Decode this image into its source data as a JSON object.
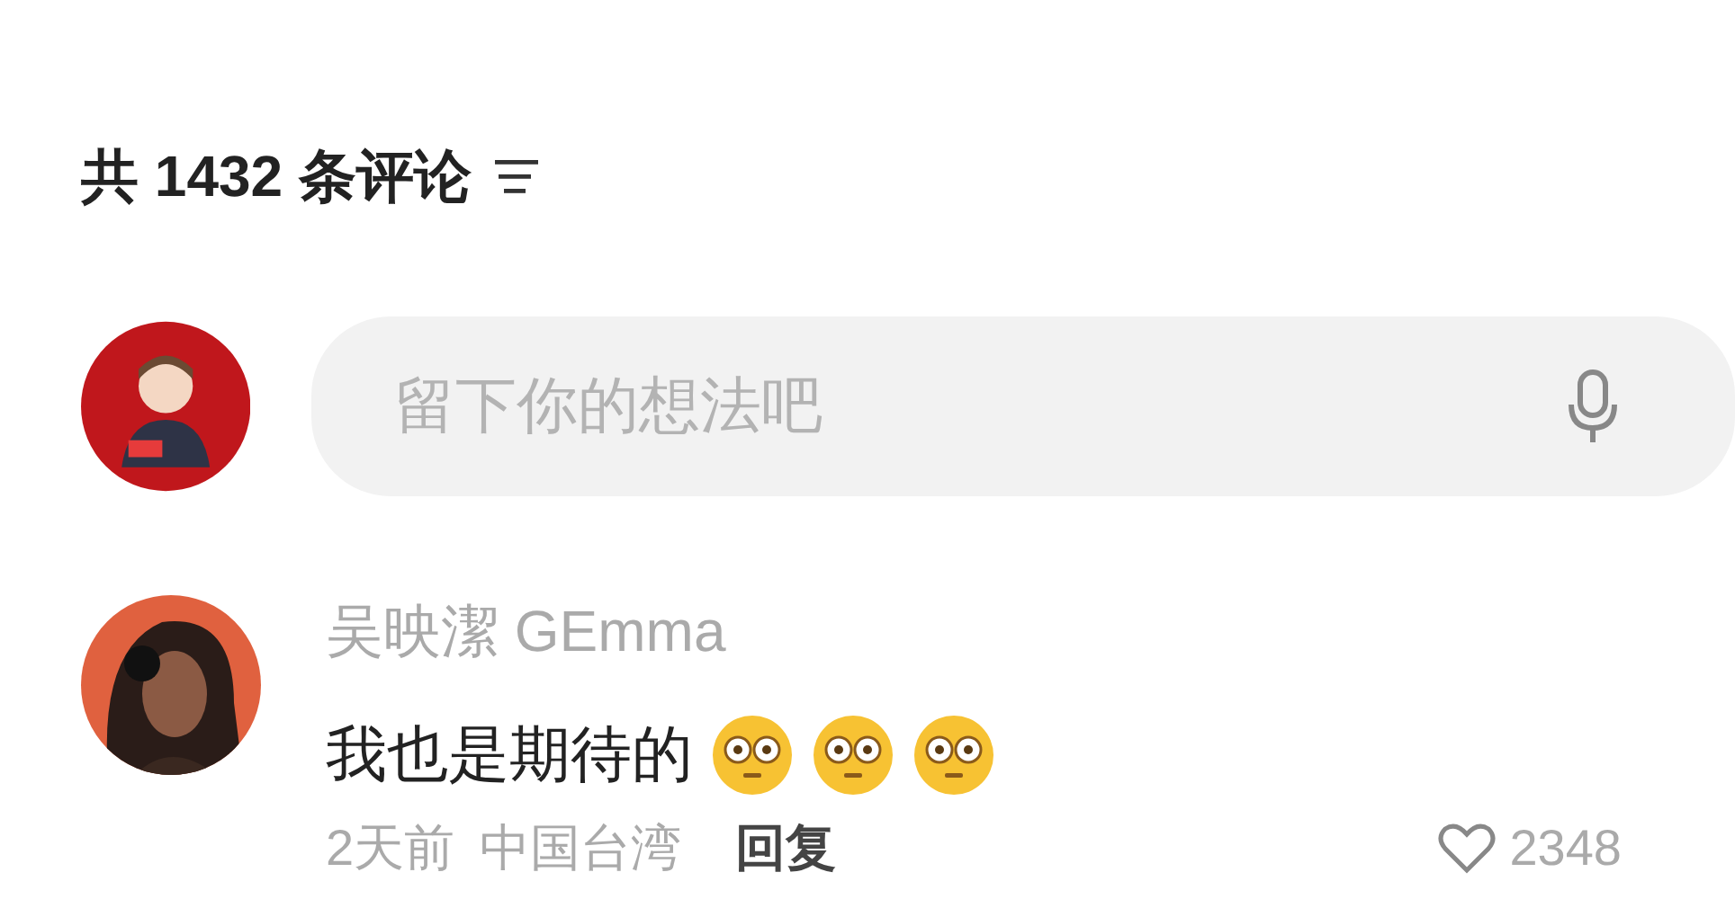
{
  "header": {
    "title": "共 1432 条评论"
  },
  "composer": {
    "placeholder": "留下你的想法吧"
  },
  "comments": [
    {
      "author": "吴映潔 GEmma",
      "text": "我也是期待的",
      "emojis": [
        {
          "kind": "flushed"
        },
        {
          "kind": "flushed"
        },
        {
          "kind": "flushed"
        }
      ],
      "time": "2天前",
      "location": "中国台湾",
      "reply": "回复",
      "likes": "2348"
    }
  ]
}
